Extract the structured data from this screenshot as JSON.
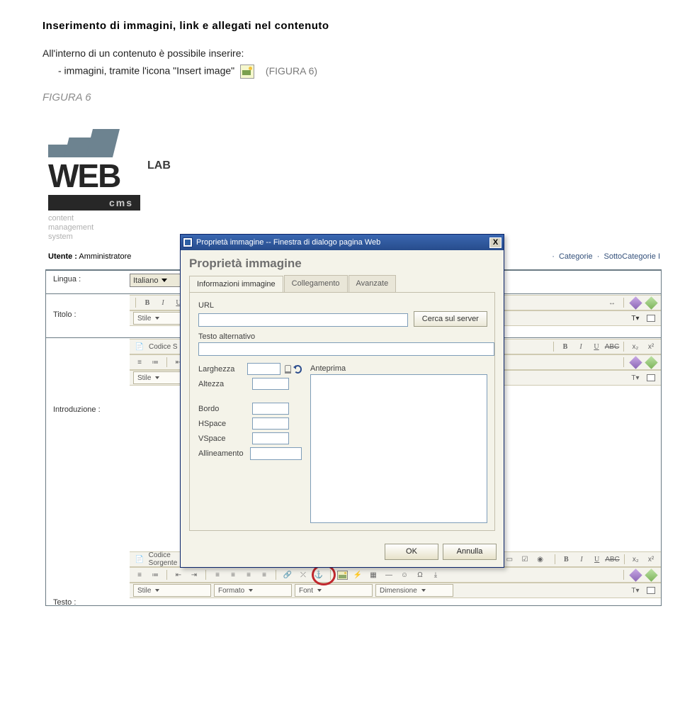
{
  "doc": {
    "heading": "Inserimento di immagini, link e allegati nel contenuto",
    "line1": "All'interno di un contenuto è possibile inserire:",
    "bullet": "- immagini, tramite l'icona \"Insert image\"",
    "figure_ref": "(FIGURA 6)",
    "figure_label": "FIGURA 6"
  },
  "logo": {
    "cms": "cms",
    "tagline1": "content",
    "tagline2": "management",
    "tagline3": "system",
    "lab": "LAB"
  },
  "user": {
    "label": "Utente :",
    "value": "Amministratore"
  },
  "top_links": {
    "a": "Categorie",
    "b": "SottoCategorie"
  },
  "form": {
    "lang_label": "Lingua :",
    "lang_value": "Italiano",
    "title_label": "Titolo :",
    "intro_label": "Introduzione :",
    "testo_label": "Testo :",
    "stile": "Stile",
    "formato": "Formato",
    "dimensione": "Dimensione",
    "codice": "Codice S",
    "codice_full": "Codice Sorgente"
  },
  "dialog": {
    "title": "Proprietà immagine -- Finestra di dialogo pagina Web",
    "heading": "Proprietà immagine",
    "tab1": "Informazioni immagine",
    "tab2": "Collegamento",
    "tab3": "Avanzate",
    "url": "URL",
    "server_btn": "Cerca sul server",
    "alt": "Testo alternativo",
    "larghezza": "Larghezza",
    "altezza": "Altezza",
    "bordo": "Bordo",
    "hspace": "HSpace",
    "vspace": "VSpace",
    "allineamento": "Allineamento",
    "anteprima": "Anteprima",
    "ok": "OK",
    "cancel": "Annulla"
  }
}
